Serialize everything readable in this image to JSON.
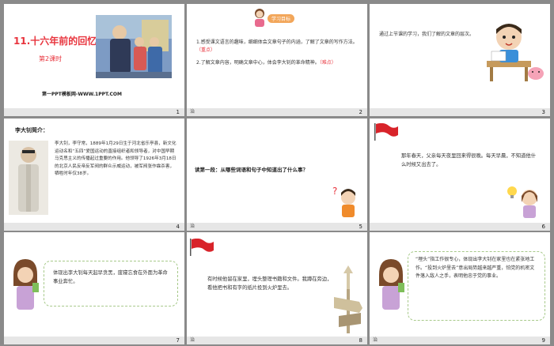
{
  "slides": [
    {
      "num": "1",
      "title": "11.十六年前的回忆",
      "subtitle": "第2课时",
      "footer_text": "第一PPT模板网-WWW.1PPT.COM"
    },
    {
      "num": "2",
      "caption": "治",
      "badge": "学习目标",
      "goal1": "1.感受课文语言的趣味，细细体会文章句子的内涵，了解了文章的写作方法。",
      "goal1_tag": "（重点）",
      "goal2": "2.了解文章内容，明确文章中心，体会李大钊的革命精神。",
      "goal2_tag": "（难点）"
    },
    {
      "num": "3",
      "text": "通过上节课的学习，我们了解的文章的层次。"
    },
    {
      "num": "4",
      "heading": "李大钊简介：",
      "text": "李大钊，李守常，1889年1月29日生于河北省乐亭县，新文化运动名和“五四”爱国运动的直接组织者和领导者，对中国早期马克思主义的传播起过重要的作用。他领导了1926年3月18日的北京人民反帝反军阀的群众示威运动，被军阀张作霖杀害，牺牲时年仅38岁。"
    },
    {
      "num": "5",
      "caption": "治",
      "text": "读第一段：从哪些词语和句子中知道出了什么事？"
    },
    {
      "num": "6",
      "text": "那年春天，父亲每天夜里回来得很晚。每天早晨，不知道他什么时候又出去了。"
    },
    {
      "num": "7",
      "text": "体现出李大钊每天起早贪黑，废寝忘食在外面为革命事业奔忙。"
    },
    {
      "num": "8",
      "caption": "治",
      "text": "有时候他留在家里，埋头整理书籍和文件。我蹲在旁边，看他把书和有字的纸片投到火炉里去。"
    },
    {
      "num": "9",
      "caption": "治",
      "text": "“埋头”指工作很专心，体现出李大钊在家里也在紧张地工作。“投到火炉里去”意出局势越来越严重，怕党的机密文件落入敌人之手，表明他忠于党的事业。"
    }
  ]
}
